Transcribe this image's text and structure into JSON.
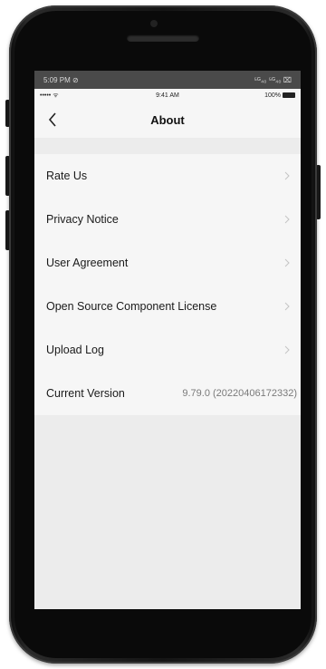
{
  "os_status": {
    "time": "5:09 PM ⊘",
    "signal": "⁵ᴳ₄₀ ⁵ᴳ₄₀ ⌧"
  },
  "ios_status": {
    "carrier": "••••• ᯤ",
    "time": "9:41 AM",
    "battery": "100%"
  },
  "nav": {
    "title": "About"
  },
  "rows": [
    {
      "label": "Rate Us"
    },
    {
      "label": "Privacy Notice"
    },
    {
      "label": "User Agreement"
    },
    {
      "label": "Open Source Component License"
    },
    {
      "label": "Upload Log"
    },
    {
      "label": "Current Version",
      "value": "9.79.0 (20220406172332)"
    }
  ],
  "icons": {
    "back": "chevron-left-icon",
    "row": "chevron-right-icon"
  },
  "colors": {
    "screen_bg": "#ececec",
    "list_bg": "#f6f6f6",
    "text": "#1a1a1a",
    "secondary": "#7a7a7a"
  }
}
